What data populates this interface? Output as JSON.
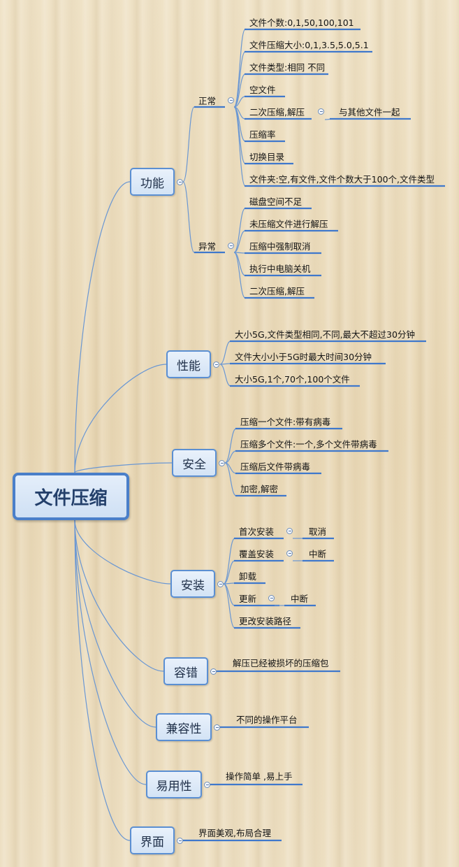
{
  "root": {
    "label": "文件压缩"
  },
  "branches": {
    "gongneng": {
      "label": "功能",
      "zhengchang": {
        "label": "正常",
        "items": [
          "文件个数:0,1,50,100,101",
          "文件压缩大小:0,1,3.5,5.0,5.1",
          "文件类型:相同 不同",
          "空文件",
          "二次压缩,解压",
          "压缩率",
          "切换目录",
          "文件夹:空,有文件,文件个数大于100个,文件类型"
        ],
        "second_compress_child": "与其他文件一起"
      },
      "yichang": {
        "label": "异常",
        "items": [
          "磁盘空间不足",
          "未压缩文件进行解压",
          "压缩中强制取消",
          "执行中电脑关机",
          "二次压缩,解压"
        ]
      }
    },
    "xingneng": {
      "label": "性能",
      "items": [
        "大小5G,文件类型相同,不同,最大不超过30分钟",
        "文件大小小于5G时最大时间30分钟",
        "大小5G,1个,70个,100个文件"
      ]
    },
    "anquan": {
      "label": "安全",
      "items": [
        "压缩一个文件:带有病毒",
        "压缩多个文件:一个,多个文件带病毒",
        "压缩后文件带病毒",
        "加密,解密"
      ]
    },
    "anzhuang": {
      "label": "安装",
      "items": [
        "首次安装",
        "覆盖安装",
        "卸载",
        "更新",
        "更改安装路径"
      ],
      "children": {
        "first": "取消",
        "overwrite": "中断",
        "update": "中断"
      }
    },
    "rongcuo": {
      "label": "容错",
      "items": [
        "解压已经被损坏的压缩包"
      ]
    },
    "jianrongxing": {
      "label": "兼容性",
      "items": [
        "不同的操作平台"
      ]
    },
    "yiyongxing": {
      "label": "易用性",
      "items": [
        "操作简单 ,易上手"
      ]
    },
    "jiemian": {
      "label": "界面",
      "items": [
        "界面美观,布局合理"
      ]
    }
  },
  "colors": {
    "connector": "#6a97d3",
    "underline": "#3f78cc",
    "node_border": "#5b8fd2"
  }
}
